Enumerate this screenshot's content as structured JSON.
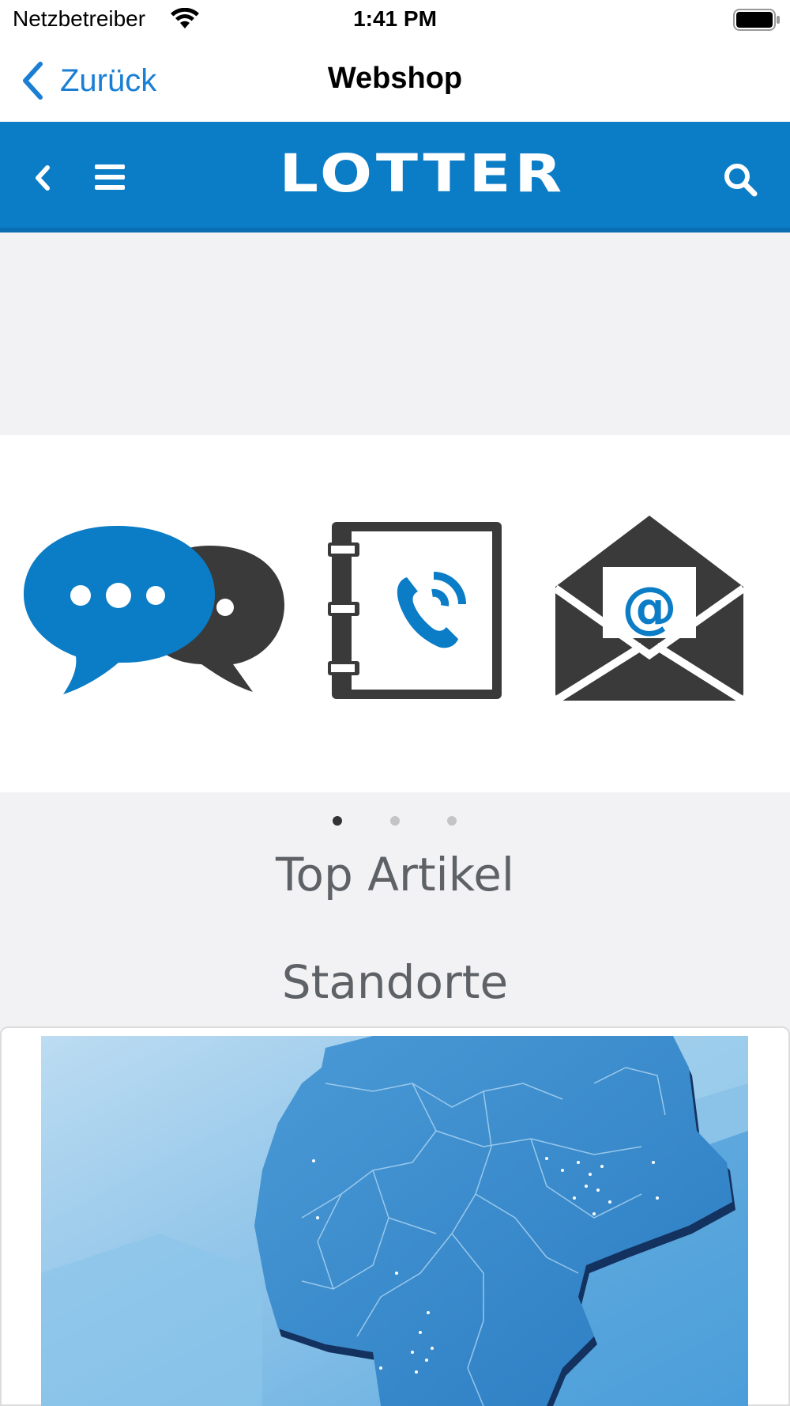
{
  "status_bar": {
    "carrier": "Netzbetreiber",
    "time": "1:41 PM",
    "wifi_icon": "wifi-icon",
    "battery_icon": "battery-icon"
  },
  "nav_bar": {
    "back_label": "Zurück",
    "title": "Webshop"
  },
  "shop_header": {
    "logo_text": "LOTTER",
    "brand_color": "#0b7cc6",
    "icons": [
      "chevron-left-icon",
      "hamburger-menu-icon",
      "search-icon"
    ]
  },
  "slider": {
    "icons": [
      "chat-bubbles-icon",
      "phone-book-icon",
      "email-envelope-icon"
    ],
    "page_count": 3,
    "active_page": 1
  },
  "sections": {
    "top_articles": "Top Artikel",
    "locations": "Standorte"
  },
  "map": {
    "icon": "germany-map-image"
  }
}
